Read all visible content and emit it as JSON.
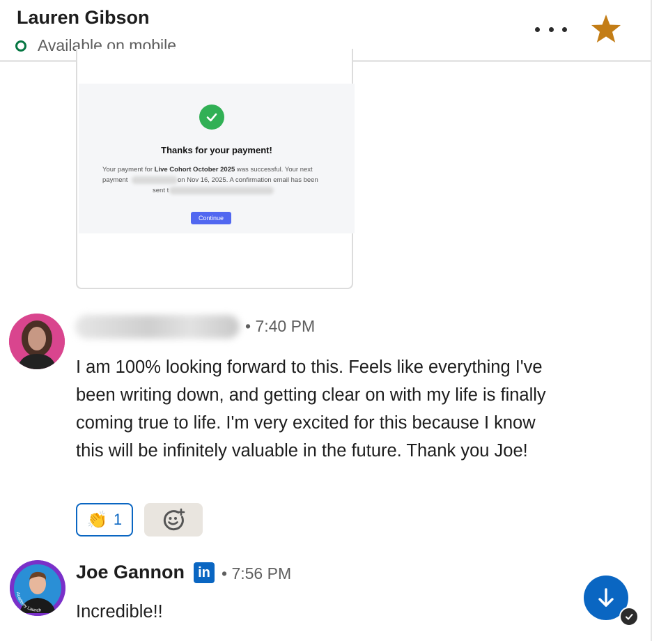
{
  "header": {
    "contact_name": "Lauren Gibson",
    "status_text": "Available on mobile",
    "more_icon": "more-horizontal-icon",
    "star_icon": "star-icon",
    "star_color": "#c37d16",
    "status_color": "#057642"
  },
  "attachment": {
    "title": "Thanks for your payment!",
    "body_prefix": "Your payment for ",
    "body_bold": "Live Cohort October 2025",
    "body_suffix": " was successful. Your next",
    "line2_start": "payment",
    "line2_end": "on Nov 16, 2025. A confirmation email has been",
    "line3_start": "sent t",
    "continue_label": "Continue",
    "accent_color": "#5167f0"
  },
  "messages": [
    {
      "time": "• 7:40 PM",
      "text": "I am 100% looking forward to this. Feels like everything I've been writing down, and getting clear on with my life is finally coming true to life. I'm very excited for this because I know this will be infinitely valuable in the future. Thank you Joe!",
      "reaction": {
        "emoji": "👏",
        "count": "1"
      }
    },
    {
      "sender": "Joe Gannon",
      "badge": "in",
      "time": "• 7:56 PM",
      "text": "Incredible!!",
      "avatar_ring_text": "Academy Launch"
    }
  ],
  "accent_color": "#0a66c2"
}
